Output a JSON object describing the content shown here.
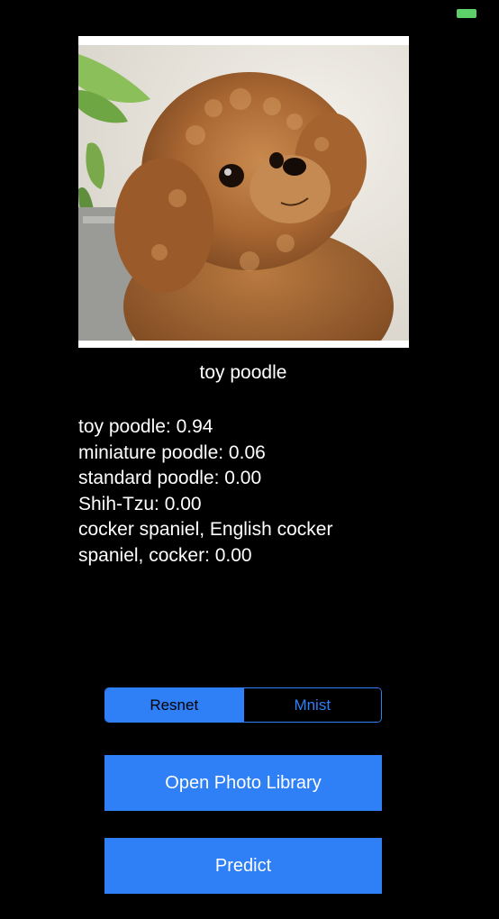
{
  "status_bar": {
    "battery_color": "#5ed06a"
  },
  "image": {
    "subject": "toy poodle puppy photo"
  },
  "result": {
    "top_label": "toy poodle"
  },
  "predictions": [
    {
      "text": "toy poodle: 0.94"
    },
    {
      "text": "miniature poodle: 0.06"
    },
    {
      "text": "standard poodle: 0.00"
    },
    {
      "text": "Shih-Tzu: 0.00"
    },
    {
      "text": "cocker spaniel, English cocker spaniel, cocker: 0.00"
    }
  ],
  "model_selector": {
    "options": [
      "Resnet",
      "Mnist"
    ],
    "selected": "Resnet"
  },
  "buttons": {
    "open_library": "Open Photo Library",
    "predict": "Predict"
  },
  "colors": {
    "accent": "#2f7ff6",
    "background": "#000000",
    "text": "#ffffff"
  }
}
